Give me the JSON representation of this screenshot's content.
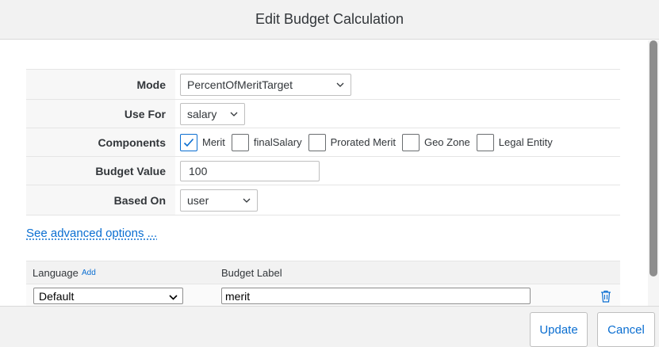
{
  "dialog": {
    "title": "Edit Budget Calculation"
  },
  "form": {
    "mode": {
      "label": "Mode",
      "value": "PercentOfMeritTarget"
    },
    "use_for": {
      "label": "Use For",
      "value": "salary"
    },
    "components": {
      "label": "Components",
      "items": [
        {
          "label": "Merit",
          "checked": true
        },
        {
          "label": "finalSalary",
          "checked": false
        },
        {
          "label": "Prorated Merit",
          "checked": false
        },
        {
          "label": "Geo Zone",
          "checked": false
        },
        {
          "label": "Legal Entity",
          "checked": false
        }
      ]
    },
    "budget_value": {
      "label": "Budget Value",
      "value": "100"
    },
    "based_on": {
      "label": "Based On",
      "value": "user"
    }
  },
  "advanced_link": "See advanced options ...",
  "language_table": {
    "header_language": "Language",
    "header_add": "Add",
    "header_budget_label": "Budget Label",
    "rows": [
      {
        "language": "Default",
        "budget_label": "merit"
      }
    ]
  },
  "footer": {
    "update_label": "Update",
    "cancel_label": "Cancel"
  },
  "icons": {
    "dropdown": "chevron-down-icon",
    "delete": "trash-icon",
    "check": "check-icon"
  },
  "colors": {
    "accent": "#0a6ed1",
    "header_bg": "#f2f2f2",
    "label_bg": "#f7f7f7"
  }
}
